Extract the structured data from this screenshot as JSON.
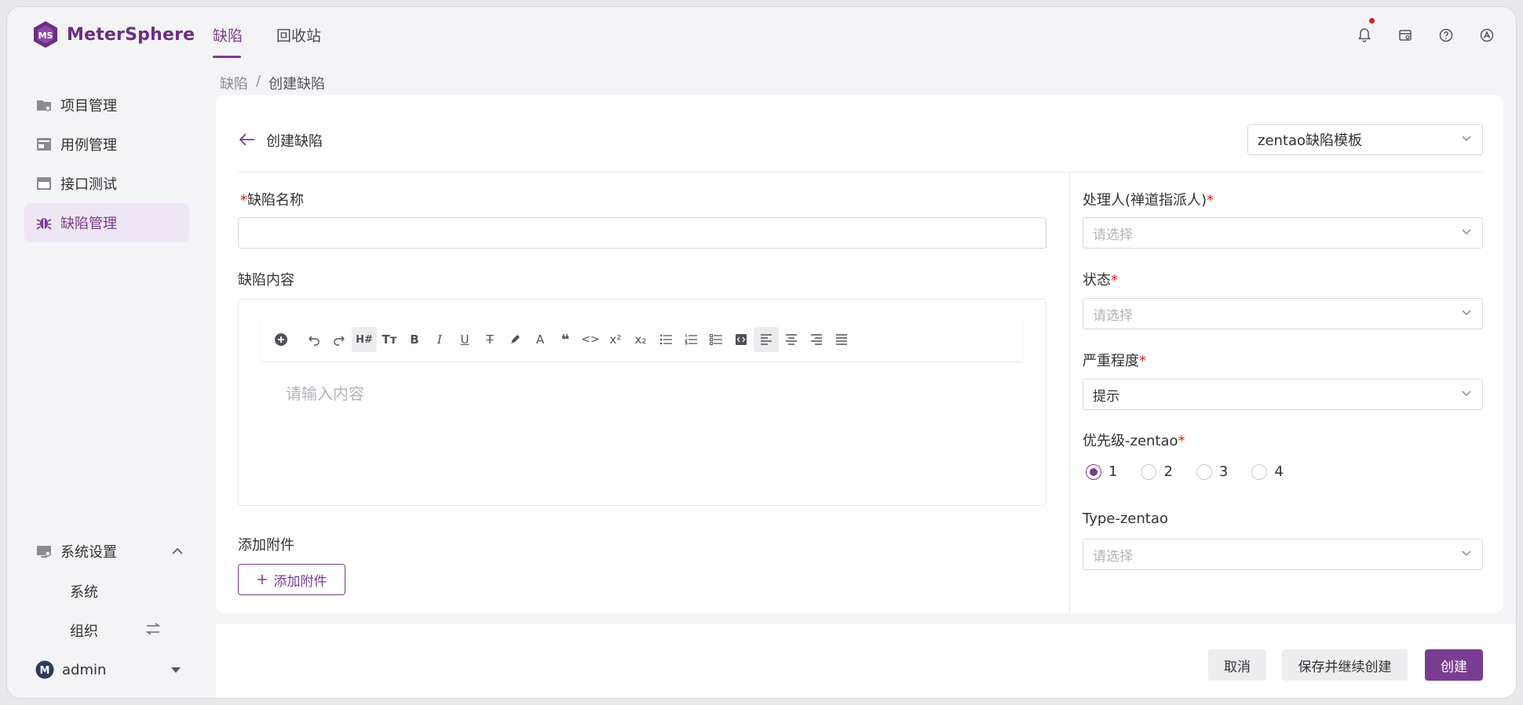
{
  "app": {
    "name": "MeterSphere"
  },
  "top_nav": {
    "tabs": [
      {
        "label": "缺陷"
      },
      {
        "label": "回收站"
      }
    ]
  },
  "sidebar": {
    "items": [
      {
        "label": "项目管理",
        "icon": "project-icon"
      },
      {
        "label": "用例管理",
        "icon": "case-icon"
      },
      {
        "label": "接口测试",
        "icon": "api-icon"
      },
      {
        "label": "缺陷管理",
        "icon": "bug-icon"
      }
    ],
    "settings": {
      "label": "系统设置",
      "sub": [
        {
          "label": "系统"
        },
        {
          "label": "组织"
        }
      ]
    },
    "user": {
      "name": "admin",
      "avatar_letter": "M"
    }
  },
  "breadcrumb": {
    "root": "缺陷",
    "sep": "/",
    "current": "创建缺陷"
  },
  "form": {
    "title": "创建缺陷",
    "template": "zentao缺陷模板",
    "name_label": "缺陷名称",
    "content_label": "缺陷内容",
    "content_placeholder": "请输入内容",
    "attach_label": "添加附件",
    "attach_button": "添加附件",
    "required_mark": "*",
    "right": {
      "assignee_label": "处理人(禅道指派人)",
      "assignee_placeholder": "请选择",
      "status_label": "状态",
      "status_placeholder": "请选择",
      "severity_label": "严重程度",
      "severity_value": "提示",
      "priority_label": "优先级-zentao",
      "priority_options": [
        "1",
        "2",
        "3",
        "4"
      ],
      "priority_selected": "1",
      "type_label": "Type-zentao",
      "type_placeholder": "请选择"
    }
  },
  "footer": {
    "cancel": "取消",
    "save_continue": "保存并继续创建",
    "create": "创建"
  },
  "colors": {
    "accent": "#7a3c91",
    "required": "#e01b1b"
  }
}
